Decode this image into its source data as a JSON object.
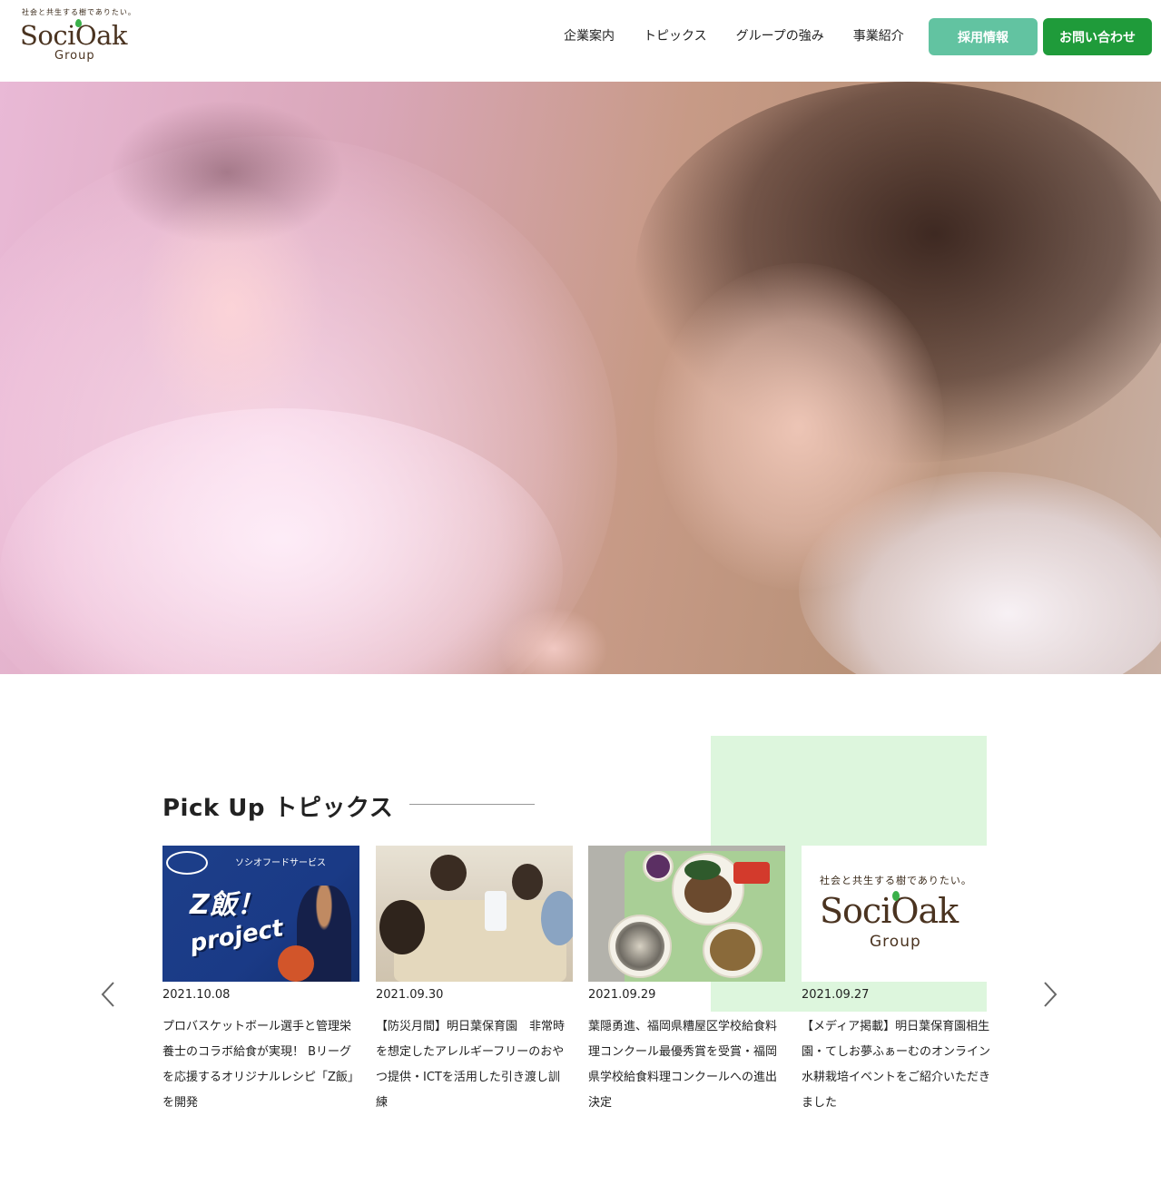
{
  "header": {
    "logo": {
      "tagline": "社会と共生する樹でありたい。",
      "wordmark": "SociOak",
      "sub": "Group"
    },
    "nav": [
      "企業案内",
      "トピックス",
      "グループの強み",
      "事業紹介"
    ],
    "recruit_button": "採用情報",
    "contact_button": "お問い合わせ"
  },
  "colors": {
    "recruit": "#62c3a1",
    "contact": "#1f9b3a",
    "accent_block": "#ddf6dd",
    "brand_brown": "#4a3320"
  },
  "pickup": {
    "title": "Pick Up トピックス",
    "cards": [
      {
        "date": "2021.10.08",
        "text": "プロバスケットボール選手と管理栄養士のコラボ給食が実現！ Bリーグを応援するオリジナルレシピ「Z飯」を開発",
        "image": {
          "brand": "ソシオフードサービス",
          "line1": "Z飯！",
          "line2": "project"
        }
      },
      {
        "date": "2021.09.30",
        "text": "【防災月間】明日葉保育園　非常時を想定したアレルギーフリーのおやつ提供・ICTを活用した引き渡し訓練"
      },
      {
        "date": "2021.09.29",
        "text": "葉隠勇進、福岡県糟屋区学校給食料理コンクール最優秀賞を受賞・福岡県学校給食料理コンクールへの進出決定"
      },
      {
        "date": "2021.09.27",
        "text": "【メディア掲載】明日葉保育園相生園・てしお夢ふぁーむのオンライン水耕栽培イベントをご紹介いただきました",
        "image": {
          "tagline": "社会と共生する樹でありたい。",
          "wordmark": "SociOak",
          "sub": "Group"
        }
      }
    ]
  },
  "icons": {
    "prev": "chevron-left-icon",
    "next": "chevron-right-icon"
  }
}
